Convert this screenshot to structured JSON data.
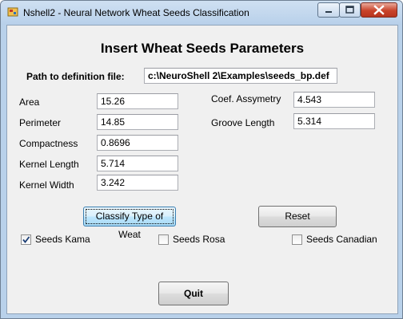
{
  "window": {
    "title": "Nshell2 - Neural Network Wheat Seeds Classification"
  },
  "heading": "Insert Wheat Seeds Parameters",
  "definition": {
    "label": "Path to definition file:",
    "value": "c:\\NeuroShell 2\\Examples\\seeds_bp.def"
  },
  "left_fields": [
    {
      "label": "Area",
      "value": "15.26"
    },
    {
      "label": "Perimeter",
      "value": "14.85"
    },
    {
      "label": "Compactness",
      "value": "0.8696"
    },
    {
      "label": "Kernel Length",
      "value": "5.714"
    },
    {
      "label": "Kernel Width",
      "value": "3.242"
    }
  ],
  "right_fields": [
    {
      "label": "Coef. Assymetry",
      "value": "4.543"
    },
    {
      "label": "Groove Length",
      "value": "5.314"
    }
  ],
  "buttons": {
    "classify": "Classify Type of Weat",
    "reset": "Reset",
    "quit": "Quit"
  },
  "checkboxes": [
    {
      "label": "Seeds Kama",
      "checked": true
    },
    {
      "label": "Seeds Rosa",
      "checked": false
    },
    {
      "label": "Seeds Canadian",
      "checked": false
    }
  ],
  "icons": {
    "app": "app-icon",
    "minimize": "minimize-icon",
    "maximize": "maximize-icon",
    "close": "close-icon",
    "check": "check-icon"
  }
}
